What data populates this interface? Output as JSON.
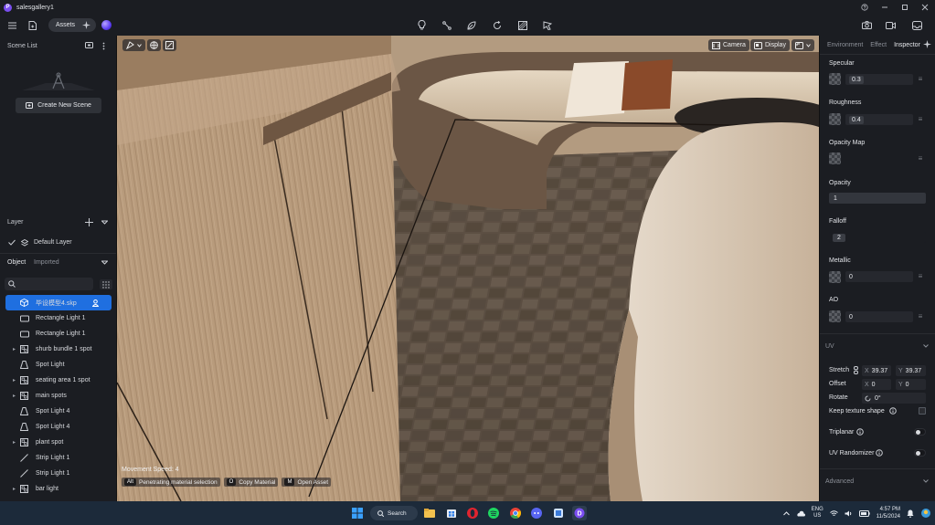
{
  "app": {
    "title": "salesgallery1",
    "logo_letter": "P"
  },
  "toolbar": {
    "assets_label": "Assets"
  },
  "left": {
    "scene_list_label": "Scene List",
    "create_scene_label": "Create New Scene",
    "layer_label": "Layer",
    "default_layer": "Default Layer",
    "tab_object": "Object",
    "tab_imported": "Imported",
    "objects": [
      {
        "label": "毕设模型4.skp",
        "icon": "cube-icon",
        "caret": false,
        "selected": true
      },
      {
        "label": "Rectangle Light 1",
        "icon": "rect-light-icon",
        "caret": false
      },
      {
        "label": "Rectangle Light 1",
        "icon": "rect-light-icon",
        "caret": false
      },
      {
        "label": "shurb bundle 1 spot",
        "icon": "group-icon",
        "caret": true
      },
      {
        "label": "Spot Light",
        "icon": "spot-light-icon",
        "caret": false
      },
      {
        "label": "seating area 1 spot",
        "icon": "group-icon",
        "caret": true
      },
      {
        "label": "main spots",
        "icon": "group-icon",
        "caret": true
      },
      {
        "label": "Spot Light 4",
        "icon": "spot-light-icon",
        "caret": false
      },
      {
        "label": "Spot Light 4",
        "icon": "spot-light-icon",
        "caret": false
      },
      {
        "label": "plant spot",
        "icon": "group-icon",
        "caret": true
      },
      {
        "label": "Strip Light 1",
        "icon": "strip-light-icon",
        "caret": false
      },
      {
        "label": "Strip Light 1",
        "icon": "strip-light-icon",
        "caret": false
      },
      {
        "label": "bar light",
        "icon": "group-icon",
        "caret": true
      }
    ]
  },
  "viewport": {
    "camera_label": "Camera",
    "display_label": "Display",
    "movement_speed": "Movement Speed: 4",
    "hints": [
      {
        "key": "Alt",
        "label": "Penetrating material selection"
      },
      {
        "key": "O",
        "label": "Copy Material"
      },
      {
        "key": "M",
        "label": "Open Asset"
      }
    ]
  },
  "inspector": {
    "tabs": [
      "Environment",
      "Effect",
      "Inspector"
    ],
    "active_tab": "Inspector",
    "specular_label": "Specular",
    "specular_value": "0.3",
    "roughness_label": "Roughness",
    "roughness_value": "0.4",
    "opacity_map_label": "Opacity Map",
    "opacity_label": "Opacity",
    "opacity_value": "1",
    "falloff_label": "Falloff",
    "falloff_value": "2",
    "metallic_label": "Metallic",
    "metallic_value": "0",
    "ao_label": "AO",
    "ao_value": "0",
    "uv_label": "UV",
    "stretch_label": "Stretch",
    "stretch_x_label": "X",
    "stretch_x": "39.37",
    "stretch_y_label": "Y",
    "stretch_y": "39.37",
    "offset_label": "Offset",
    "offset_x_label": "X",
    "offset_x": "0",
    "offset_y_label": "Y",
    "offset_y": "0",
    "rotate_label": "Rotate",
    "rotate_value": "0°",
    "keep_texture_label": "Keep texture shape",
    "triplanar_label": "Triplanar",
    "uv_randomizer_label": "UV Randomizer",
    "advanced_label": "Advanced"
  },
  "taskbar": {
    "search_label": "Search",
    "lang_top": "ENG",
    "lang_bottom": "US",
    "time": "4:57 PM",
    "date": "11/5/2024"
  }
}
